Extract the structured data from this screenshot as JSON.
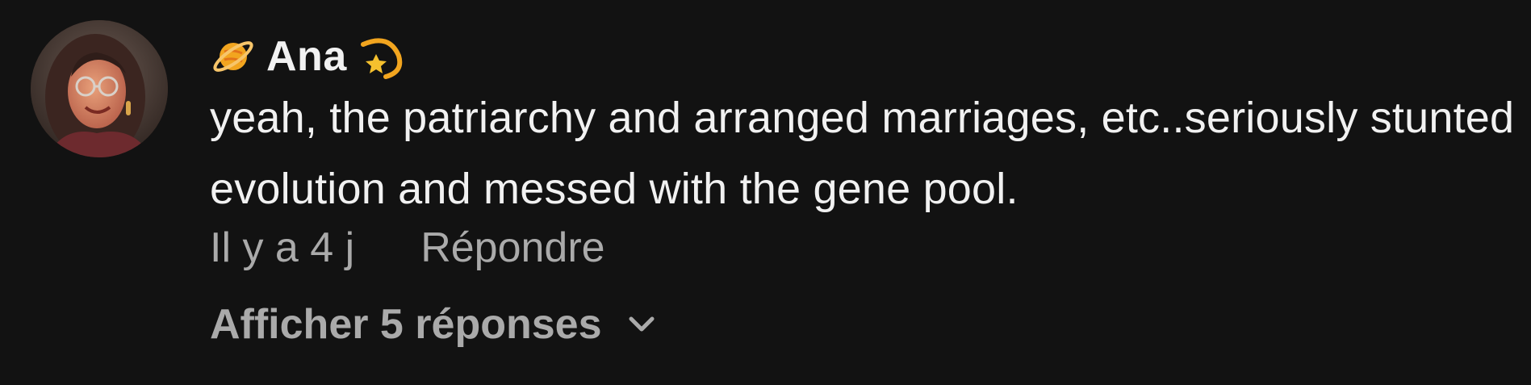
{
  "comment": {
    "author": "Ana",
    "author_prefix_icon": "ringed-planet-icon",
    "author_suffix_icon": "dizzy-star-icon",
    "text": "yeah, the patriarchy and arranged marriages, etc..seriously stunted evolution and messed with the gene pool.",
    "timestamp": "Il y a 4 j",
    "reply_label": "Répondre",
    "show_replies_label": "Afficher 5 réponses"
  },
  "colors": {
    "background": "#121212",
    "primary_text": "#f1f1f1",
    "secondary_text": "#aaaaaa",
    "emoji_gold": "#f2a51f"
  }
}
